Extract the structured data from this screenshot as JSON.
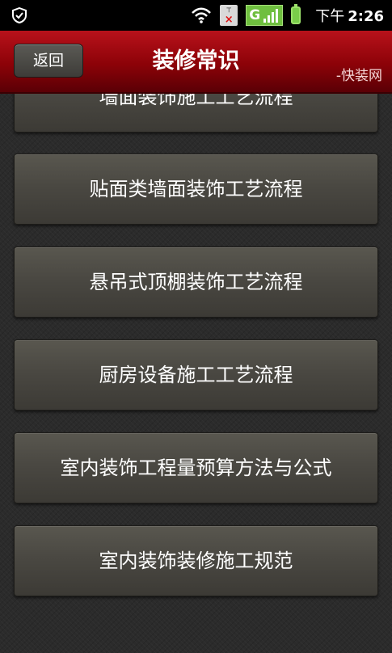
{
  "status_bar": {
    "time_ampm": "下午",
    "time": "2:26",
    "network_type": "G",
    "icons": [
      "shield-icon",
      "wifi-icon",
      "no-sim-icon",
      "signal-icon",
      "battery-icon"
    ],
    "colors": {
      "background": "#000000",
      "signal_bg": "#6fbf3f",
      "battery": "#7acc4a",
      "no_sim_mark": "#dd1111"
    }
  },
  "header": {
    "back_label": "返回",
    "title": "装修常识",
    "brand": "-快装网",
    "colors": {
      "bar_top": "#b8121b",
      "bar_bottom": "#5a0005",
      "back_button": "#4a4944"
    }
  },
  "list": {
    "items": [
      {
        "label": "墙面装饰施工工艺流程",
        "partially_visible": true
      },
      {
        "label": "贴面类墙面装饰工艺流程"
      },
      {
        "label": "悬吊式顶棚装饰工艺流程"
      },
      {
        "label": "厨房设备施工工艺流程"
      },
      {
        "label": "室内装饰工程量预算方法与公式"
      },
      {
        "label": "室内装饰装修施工规范"
      }
    ],
    "colors": {
      "item_bg": "#4a4842",
      "item_text": "#ffffff",
      "page_bg": "#2b2b2b"
    }
  }
}
